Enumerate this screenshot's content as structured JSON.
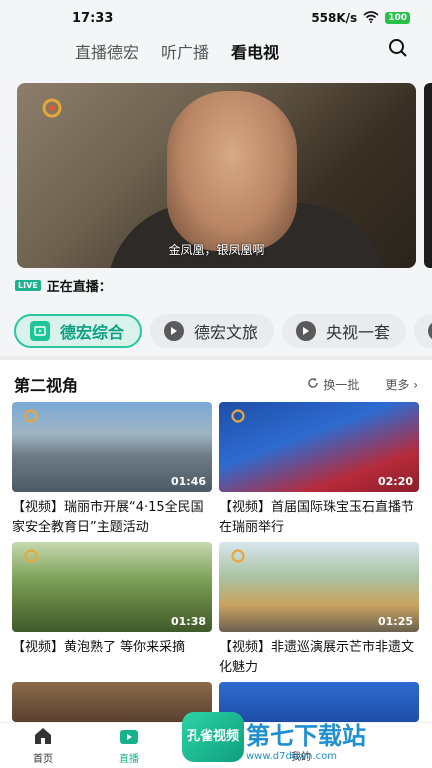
{
  "status": {
    "time": "17:33",
    "speed": "558K/s",
    "battery": "100"
  },
  "tabs": [
    "直播德宏",
    "听广播",
    "看电视"
  ],
  "active_tab": 2,
  "hero": {
    "subtitle": "金凤凰，银凤凰啊"
  },
  "live": {
    "badge": "LIVE",
    "label": "正在直播："
  },
  "channels": [
    "德宏综合",
    "德宏文旅",
    "央视一套"
  ],
  "section": {
    "title": "第二视角",
    "refresh": "换一批",
    "more": "更多"
  },
  "cards": [
    {
      "title": "【视频】瑞丽市开展“4·15全民国家安全教育日”主题活动",
      "duration": "01:46"
    },
    {
      "title": "【视频】首届国际珠宝玉石直播节在瑞丽举行",
      "duration": "02:20"
    },
    {
      "title": "【视频】黄泡熟了 等你来采摘",
      "duration": "01:38"
    },
    {
      "title": "【视频】非遗巡演展示芒市非遗文化魅力",
      "duration": "01:25"
    }
  ],
  "nav": [
    "首页",
    "直播",
    "社区",
    "我的"
  ],
  "watermark": {
    "left": "孔雀视频",
    "brand": "第七下载站",
    "url": "www.d7down.com"
  },
  "colors": {
    "accent": "#1ec596",
    "nav_active": "#17b38c"
  }
}
